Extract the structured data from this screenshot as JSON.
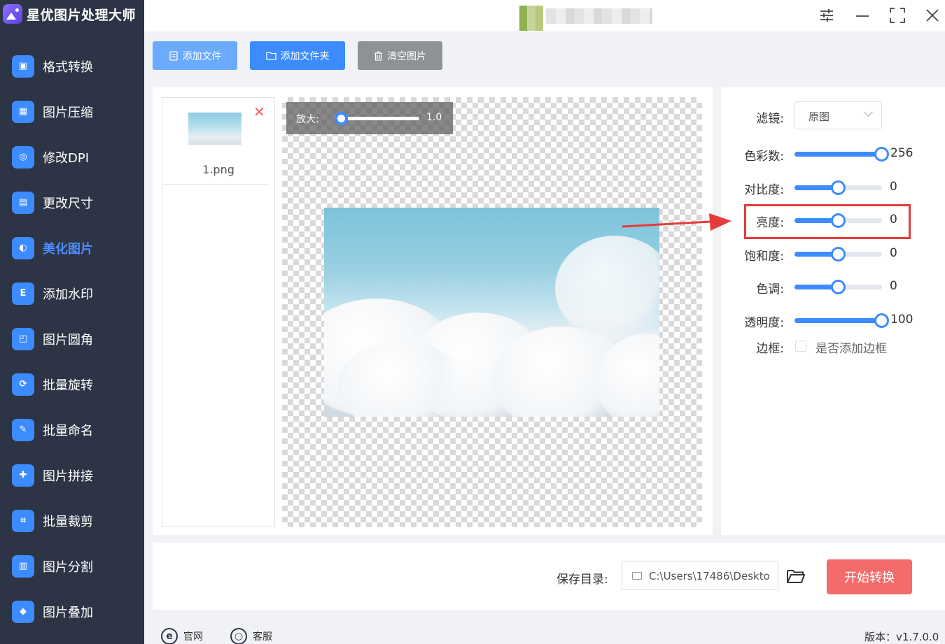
{
  "app": {
    "title": "星优图片处理大师"
  },
  "sidebar": {
    "items": [
      {
        "label": "格式转换",
        "icon": "image-convert-icon",
        "color": "#3c8cff"
      },
      {
        "label": "图片压缩",
        "icon": "image-compress-icon",
        "color": "#3c8cff"
      },
      {
        "label": "修改DPI",
        "icon": "dpi-icon",
        "color": "#3c8cff"
      },
      {
        "label": "更改尺寸",
        "icon": "resize-icon",
        "color": "#3c8cff"
      },
      {
        "label": "美化图片",
        "icon": "beautify-icon",
        "color": "#3c8cff",
        "active": true
      },
      {
        "label": "添加水印",
        "icon": "watermark-icon",
        "color": "#3c8cff"
      },
      {
        "label": "图片圆角",
        "icon": "round-corner-icon",
        "color": "#3c8cff"
      },
      {
        "label": "批量旋转",
        "icon": "rotate-icon",
        "color": "#3c8cff"
      },
      {
        "label": "批量命名",
        "icon": "rename-icon",
        "color": "#3c8cff"
      },
      {
        "label": "图片拼接",
        "icon": "puzzle-icon",
        "color": "#3c8cff"
      },
      {
        "label": "批量裁剪",
        "icon": "crop-icon",
        "color": "#3c8cff"
      },
      {
        "label": "图片分割",
        "icon": "split-icon",
        "color": "#3c8cff"
      },
      {
        "label": "图片叠加",
        "icon": "layers-icon",
        "color": "#3c8cff"
      }
    ]
  },
  "toolbar": {
    "add_file": "添加文件",
    "add_folder": "添加文件夹",
    "clear": "清空图片"
  },
  "file_list": {
    "files": [
      {
        "name": "1.png"
      }
    ]
  },
  "preview": {
    "zoom_label": "放大:",
    "zoom_value": "1.0",
    "zoom_level": 0
  },
  "settings": {
    "filter_label": "滤镜:",
    "filter_value": "原图",
    "sliders": [
      {
        "label": "色彩数:",
        "value": "256",
        "fraction": 1.0
      },
      {
        "label": "对比度:",
        "value": "0",
        "fraction": 0.5
      },
      {
        "label": "亮度:",
        "value": "0",
        "fraction": 0.5
      },
      {
        "label": "饱和度:",
        "value": "0",
        "fraction": 0.5
      },
      {
        "label": "色调:",
        "value": "0",
        "fraction": 0.5
      },
      {
        "label": "透明度:",
        "value": "100",
        "fraction": 1.0
      }
    ],
    "border_label": "边框:",
    "border_checkbox_label": "是否添加边框",
    "border_checked": false
  },
  "bottom": {
    "save_dir_label": "保存目录:",
    "save_dir_value": "C:\\Users\\17486\\Deskto",
    "start_button": "开始转换"
  },
  "footer": {
    "website": "官网",
    "support": "客服",
    "version": "版本：v1.7.0.0"
  },
  "colors": {
    "accent": "#3c8cff",
    "start_button": "#f36b6b",
    "highlight": "#e53b3b",
    "sidebar_bg": "#2d3445"
  }
}
